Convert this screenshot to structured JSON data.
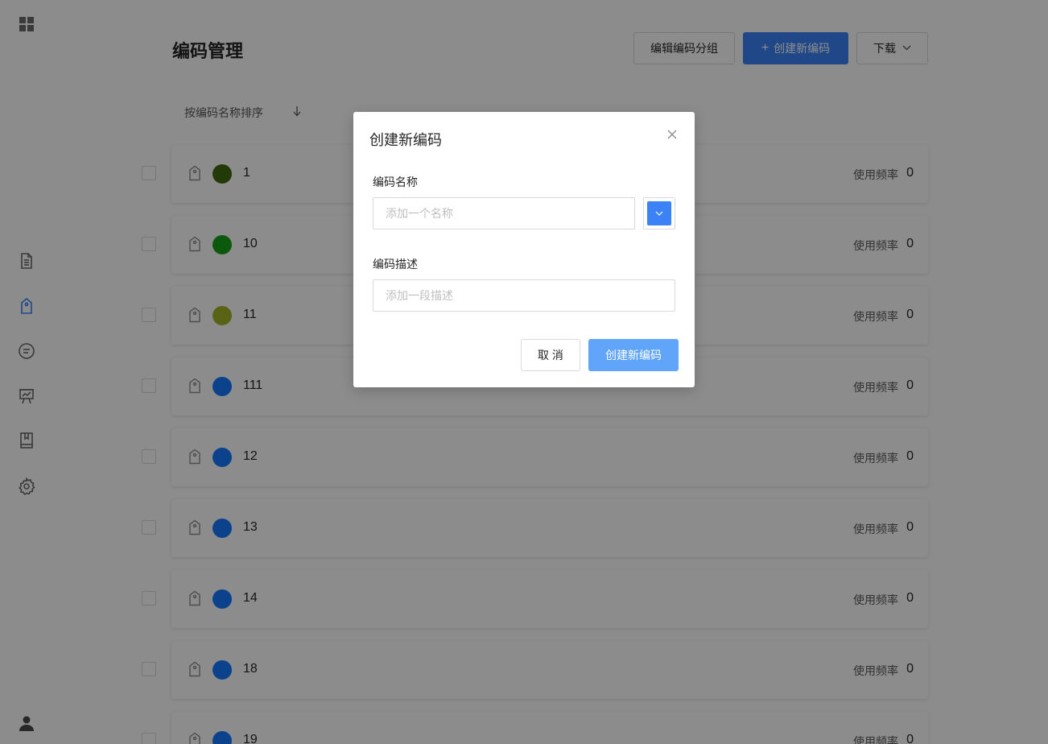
{
  "sidebar": {
    "icons": [
      "grid-icon",
      "document-icon",
      "tag-icon",
      "chat-icon",
      "presentation-icon",
      "book-icon",
      "gear-icon",
      "user-icon"
    ],
    "active_color": "#3b82f6"
  },
  "header": {
    "title": "编码管理",
    "edit_group_label": "编辑编码分组",
    "create_label": "创建新编码",
    "download_label": "下载"
  },
  "sort": {
    "label": "按编码名称排序"
  },
  "codes": [
    {
      "name": "1",
      "color": "#3d6b0f",
      "freq_label": "使用频率",
      "freq": "0"
    },
    {
      "name": "10",
      "color": "#17a017",
      "freq_label": "使用频率",
      "freq": "0"
    },
    {
      "name": "11",
      "color": "#a3b428",
      "freq_label": "使用频率",
      "freq": "0"
    },
    {
      "name": "111",
      "color": "#1677ff",
      "freq_label": "使用频率",
      "freq": "0"
    },
    {
      "name": "12",
      "color": "#1677ff",
      "freq_label": "使用频率",
      "freq": "0"
    },
    {
      "name": "13",
      "color": "#1677ff",
      "freq_label": "使用频率",
      "freq": "0"
    },
    {
      "name": "14",
      "color": "#1677ff",
      "freq_label": "使用频率",
      "freq": "0"
    },
    {
      "name": "18",
      "color": "#1677ff",
      "freq_label": "使用频率",
      "freq": "0"
    },
    {
      "name": "19",
      "color": "#1677ff",
      "freq_label": "使用频率",
      "freq": "0"
    }
  ],
  "modal": {
    "title": "创建新编码",
    "name_label": "编码名称",
    "name_placeholder": "添加一个名称",
    "desc_label": "编码描述",
    "desc_placeholder": "添加一段描述",
    "selected_color": "#3b82f6",
    "cancel_label": "取 消",
    "submit_label": "创建新编码"
  }
}
